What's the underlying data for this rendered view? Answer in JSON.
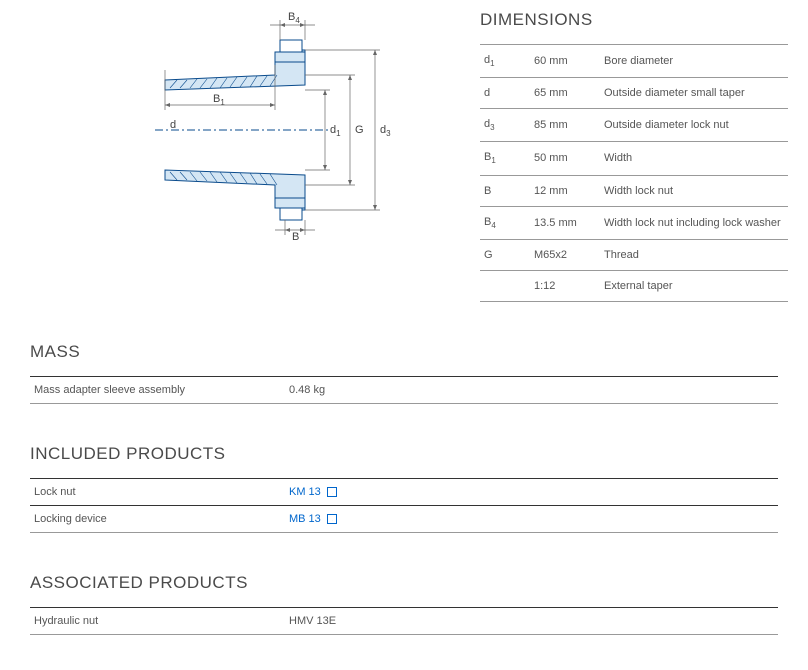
{
  "dimensions": {
    "heading": "DIMENSIONS",
    "rows": [
      {
        "symbol_html": "d<span class='sub'>1</span>",
        "value": "60 mm",
        "desc": "Bore diameter"
      },
      {
        "symbol_html": "d",
        "value": "65 mm",
        "desc": "Outside diameter small taper"
      },
      {
        "symbol_html": "d<span class='sub'>3</span>",
        "value": "85 mm",
        "desc": "Outside diameter lock nut"
      },
      {
        "symbol_html": "B<span class='sub'>1</span>",
        "value": "50 mm",
        "desc": "Width"
      },
      {
        "symbol_html": "B",
        "value": "12 mm",
        "desc": "Width lock nut"
      },
      {
        "symbol_html": "B<span class='sub'>4</span>",
        "value": "13.5 mm",
        "desc": "Width lock nut including lock washer"
      },
      {
        "symbol_html": "G",
        "value": "M65x2",
        "desc": "Thread"
      },
      {
        "symbol_html": "",
        "value": "1:12",
        "desc": "External taper"
      }
    ]
  },
  "mass": {
    "heading": "MASS",
    "rows": [
      {
        "label": "Mass adapter sleeve assembly",
        "value": "0.48 kg"
      }
    ]
  },
  "included": {
    "heading": "INCLUDED PRODUCTS",
    "rows": [
      {
        "label": "Lock nut",
        "link": "KM 13"
      },
      {
        "label": "Locking device",
        "link": "MB 13"
      }
    ]
  },
  "associated": {
    "heading": "ASSOCIATED PRODUCTS",
    "rows": [
      {
        "label": "Hydraulic nut",
        "value": "HMV 13E"
      }
    ]
  },
  "diagram_labels": {
    "B4": "B",
    "B4sub": "4",
    "B1": "B",
    "B1sub": "1",
    "d": "d",
    "d1": "d",
    "d1sub": "1",
    "G": "G",
    "d3": "d",
    "d3sub": "3",
    "B": "B"
  }
}
